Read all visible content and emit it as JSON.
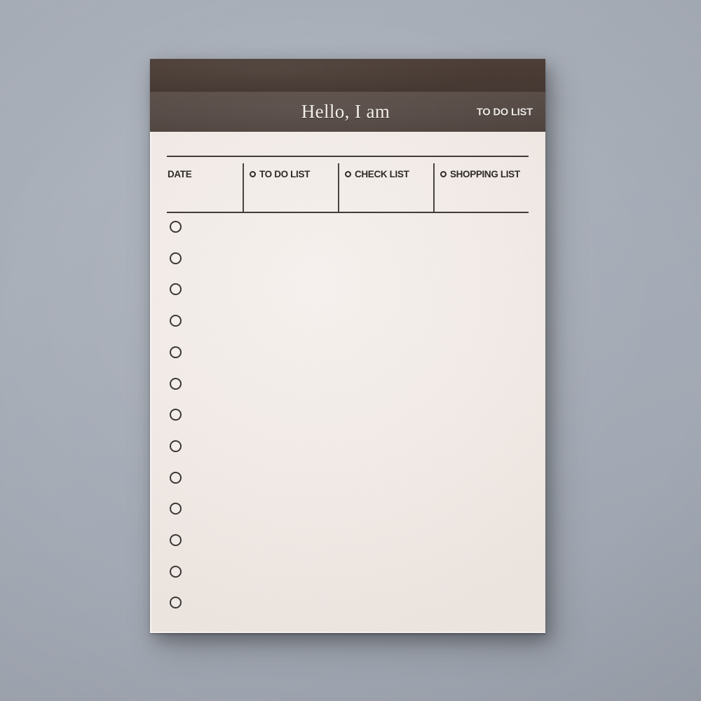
{
  "scene": {
    "background_color": "#a8aeb8",
    "description": "to-do-list notepad photographed on a gray surface"
  },
  "notepad": {
    "paper_color": "#f2ebe7",
    "band_dark_color": "#483a33",
    "band_title_color": "#544843",
    "ink_color": "#2e2a27",
    "header": {
      "title": "Hello, I am",
      "tag": "TO DO LIST"
    },
    "table": {
      "columns": [
        {
          "label": "DATE",
          "has_bullet": false
        },
        {
          "label": "TO DO LIST",
          "has_bullet": true
        },
        {
          "label": "CHECK LIST",
          "has_bullet": true
        },
        {
          "label": "SHOPPING LIST",
          "has_bullet": true
        }
      ]
    },
    "punch_holes": {
      "count": 13,
      "shape": "circle"
    }
  }
}
